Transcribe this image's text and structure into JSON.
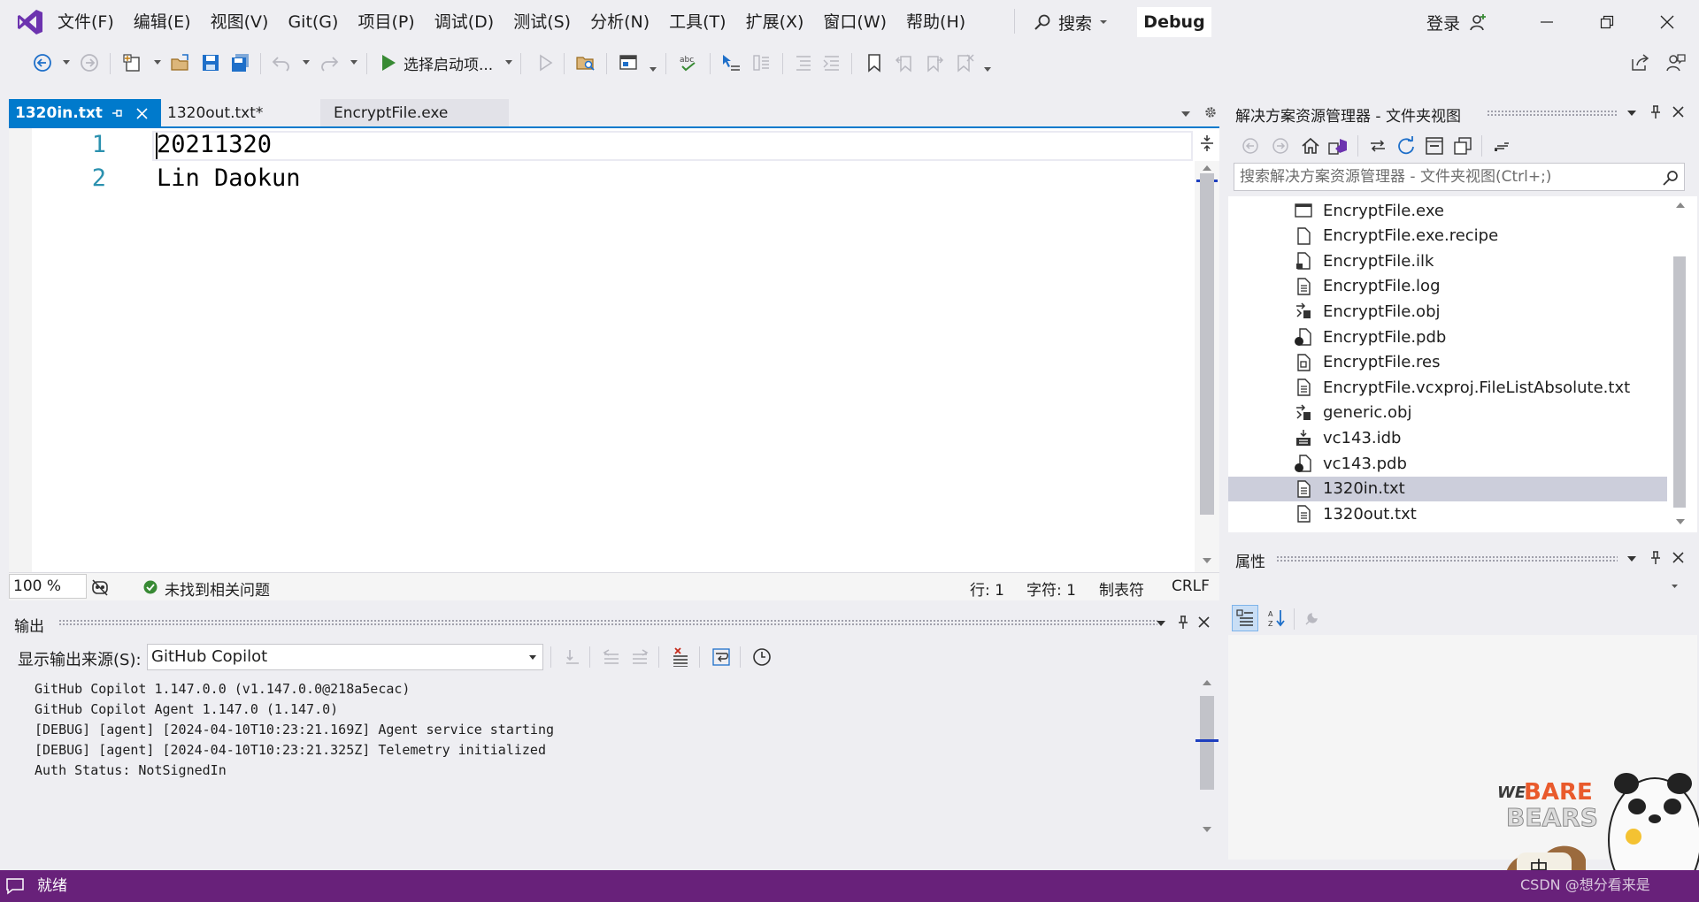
{
  "menu": {
    "items": [
      "文件(F)",
      "编辑(E)",
      "视图(V)",
      "Git(G)",
      "项目(P)",
      "调试(D)",
      "测试(S)",
      "分析(N)",
      "工具(T)",
      "扩展(X)",
      "窗口(W)",
      "帮助(H)"
    ],
    "search_label": "搜索",
    "config": "Debug",
    "login_label": "登录"
  },
  "toolbar": {
    "start_label": "选择启动项..."
  },
  "editor": {
    "tabs": [
      {
        "label": "1320in.txt",
        "active": true
      },
      {
        "label": "1320out.txt*",
        "active": false
      },
      {
        "label": "EncryptFile.exe",
        "active": false
      }
    ],
    "lines": [
      {
        "num": "1",
        "text": "20211320"
      },
      {
        "num": "2",
        "text": "Lin Daokun"
      }
    ],
    "zoom": "100 %",
    "issues": "未找到相关问题",
    "status": {
      "line": "行: 1",
      "char": "字符: 1",
      "tabs": "制表符",
      "eol": "CRLF"
    }
  },
  "output": {
    "title": "输出",
    "source_label": "显示输出来源(S):",
    "source_value": "GitHub Copilot",
    "lines": [
      "GitHub Copilot 1.147.0.0 (v1.147.0.0@218a5ecac)",
      "GitHub Copilot Agent 1.147.0 (1.147.0)",
      "[DEBUG] [agent] [2024-04-10T10:23:21.169Z] Agent service starting",
      "[DEBUG] [agent] [2024-04-10T10:23:21.325Z] Telemetry initialized",
      "Auth Status: NotSignedIn"
    ]
  },
  "solution_explorer": {
    "title": "解决方案资源管理器 - 文件夹视图",
    "search_placeholder": "搜索解决方案资源管理器 - 文件夹视图(Ctrl+;)",
    "files": [
      {
        "name": "EncryptFile.exe",
        "icon": "exe-window-icon",
        "selected": false
      },
      {
        "name": "EncryptFile.exe.recipe",
        "icon": "file-icon",
        "selected": false
      },
      {
        "name": "EncryptFile.ilk",
        "icon": "file-link-icon",
        "selected": false
      },
      {
        "name": "EncryptFile.log",
        "icon": "text-file-icon",
        "selected": false
      },
      {
        "name": "EncryptFile.obj",
        "icon": "object-file-icon",
        "selected": false
      },
      {
        "name": "EncryptFile.pdb",
        "icon": "pdb-file-icon",
        "selected": false
      },
      {
        "name": "EncryptFile.res",
        "icon": "resource-file-icon",
        "selected": false
      },
      {
        "name": "EncryptFile.vcxproj.FileListAbsolute.txt",
        "icon": "text-file-icon",
        "selected": false
      },
      {
        "name": "generic.obj",
        "icon": "object-file-icon",
        "selected": false
      },
      {
        "name": "vc143.idb",
        "icon": "idb-file-icon",
        "selected": false
      },
      {
        "name": "vc143.pdb",
        "icon": "pdb-file-icon",
        "selected": false
      },
      {
        "name": "1320in.txt",
        "icon": "text-file-icon",
        "selected": true
      },
      {
        "name": "1320out.txt",
        "icon": "text-file-icon",
        "selected": false
      }
    ]
  },
  "properties": {
    "title": "属性"
  },
  "statusbar": {
    "text": "就绪",
    "watermark": "CSDN @想分看来是",
    "ime": "中"
  },
  "sticker": {
    "brand_top": "WE",
    "brand_mid": "BARE",
    "brand_bottom": "BEARS"
  },
  "colors": {
    "accent": "#007acc",
    "statusbar": "#68217a",
    "vs_logo": "#6c33af",
    "selection": "#cccedb",
    "line_number": "#2b91af",
    "run_green": "#388a34"
  }
}
